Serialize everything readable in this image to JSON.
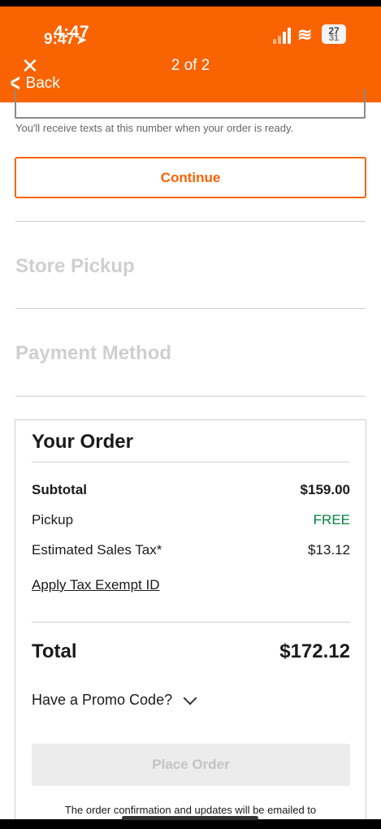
{
  "status_bar": {
    "time_front": "4:47",
    "time_back": "9:47",
    "battery_front": "27",
    "battery_back": "31"
  },
  "header": {
    "close_icon": "close-icon",
    "back_label": "Back",
    "step_label": "2 of 2",
    "brand_color": "#f96302"
  },
  "contact": {
    "helper_text": "You'll receive texts at this number when your order is ready."
  },
  "continue_label": "Continue",
  "sections": {
    "store_pickup": "Store Pickup",
    "payment_method": "Payment Method"
  },
  "order": {
    "title": "Your Order",
    "subtotal_label": "Subtotal",
    "subtotal_value": "$159.00",
    "pickup_label": "Pickup",
    "pickup_value": "FREE",
    "tax_label": "Estimated Sales Tax*",
    "tax_value": "$13.12",
    "tax_exempt_link": "Apply Tax Exempt ID",
    "total_label": "Total",
    "total_value": "$172.12",
    "promo_label": "Have a Promo Code?",
    "place_order_label": "Place Order",
    "confirmation_note": "The order confirmation and updates will be emailed to"
  }
}
